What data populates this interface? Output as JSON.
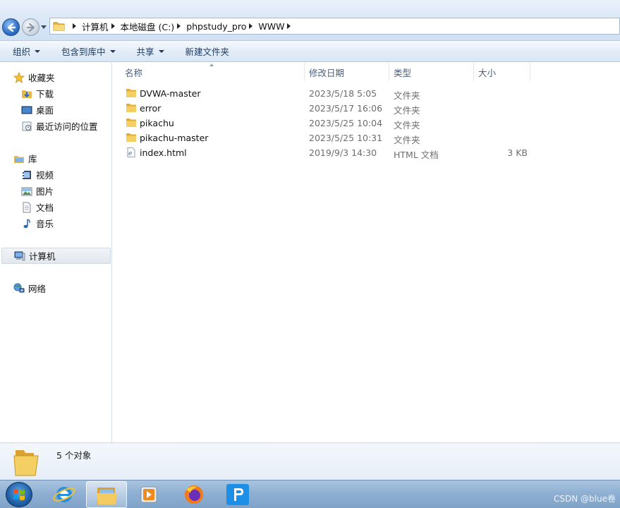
{
  "address": {
    "crumbs": [
      "计算机",
      "本地磁盘 (C:)",
      "phpstudy_pro",
      "WWW"
    ]
  },
  "toolbar": {
    "organize_label": "组织",
    "include_label": "包含到库中",
    "share_label": "共享",
    "new_folder_label": "新建文件夹"
  },
  "nav": {
    "favorites": "收藏夹",
    "downloads": "下载",
    "desktop": "桌面",
    "recent": "最近访问的位置",
    "libraries": "库",
    "videos": "视频",
    "pictures": "图片",
    "documents": "文档",
    "music": "音乐",
    "computer": "计算机",
    "network": "网络"
  },
  "columns": {
    "name": "名称",
    "date": "修改日期",
    "type": "类型",
    "size": "大小"
  },
  "files": [
    {
      "name": "DVWA-master",
      "date": "2023/5/18 5:05",
      "type": "文件夹",
      "size": "",
      "icon": "folder-icon"
    },
    {
      "name": "error",
      "date": "2023/5/17 16:06",
      "type": "文件夹",
      "size": "",
      "icon": "folder-icon"
    },
    {
      "name": "pikachu",
      "date": "2023/5/25 10:04",
      "type": "文件夹",
      "size": "",
      "icon": "folder-icon"
    },
    {
      "name": "pikachu-master",
      "date": "2023/5/25 10:31",
      "type": "文件夹",
      "size": "",
      "icon": "folder-icon"
    },
    {
      "name": "index.html",
      "date": "2019/9/3 14:30",
      "type": "HTML 文档",
      "size": "3 KB",
      "icon": "html-file-icon"
    }
  ],
  "details": {
    "count": "5 个对象"
  },
  "taskbar": {
    "watermark": "CSDN @blue卷"
  },
  "colors": {
    "accent": "#1f5fa8",
    "folder": "#f2c94c",
    "toolbar_text": "#1e395b"
  }
}
